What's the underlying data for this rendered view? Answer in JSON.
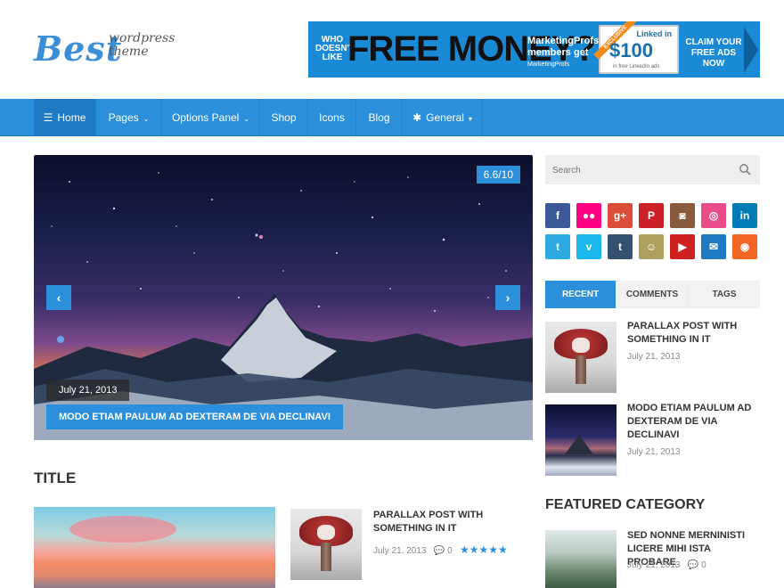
{
  "logo": {
    "name": "Best",
    "sub": "wordpress theme"
  },
  "banner": {
    "who": "WHO DOESN'T LIKE",
    "free": "FREE MONEY?",
    "mp": "MarketingProfs members get",
    "mp_small": "MarketingProfs",
    "card_brand": "Linked in",
    "card_amount": "$100",
    "card_small": "in free LinkedIn ads",
    "exclusive": "EXCLUSIVE",
    "claim": "CLAIM YOUR FREE ADS NOW"
  },
  "nav": {
    "items": [
      {
        "label": "Home",
        "icon": "bars-icon",
        "glyph": "☰"
      },
      {
        "label": "Pages",
        "caret": "⌄"
      },
      {
        "label": "Options Panel",
        "caret": "⌄"
      },
      {
        "label": "Shop"
      },
      {
        "label": "Icons"
      },
      {
        "label": "Blog"
      },
      {
        "label": "General",
        "icon": "asterisk-icon",
        "glyph": "✱",
        "caret": "▾"
      }
    ]
  },
  "slider": {
    "score": "6.6/10",
    "date": "July 21, 2013",
    "title": "MODO ETIAM PAULUM AD DEXTERAM DE VIA DECLINAVI",
    "prev": "‹",
    "next": "›"
  },
  "main": {
    "section_title": "TITLE",
    "post": {
      "title": "PARALLAX POST WITH SOMETHING IN IT",
      "date": "July 21, 2013",
      "comments": "0",
      "rating": 5,
      "rating_stars": "★★★★★"
    }
  },
  "sidebar": {
    "search_placeholder": "Search",
    "social": [
      {
        "name": "facebook-icon",
        "glyph": "f",
        "color": "#3b5998"
      },
      {
        "name": "flickr-icon",
        "glyph": "●●",
        "color": "#ff0084"
      },
      {
        "name": "google-plus-icon",
        "glyph": "g+",
        "color": "#dd4b39"
      },
      {
        "name": "pinterest-icon",
        "glyph": "P",
        "color": "#cb2027"
      },
      {
        "name": "instagram-icon",
        "glyph": "◙",
        "color": "#8a5a3c"
      },
      {
        "name": "dribbble-icon",
        "glyph": "◎",
        "color": "#ea4c89"
      },
      {
        "name": "linkedin-icon",
        "glyph": "in",
        "color": "#007bb6"
      },
      {
        "name": "twitter-icon",
        "glyph": "t",
        "color": "#2daae1"
      },
      {
        "name": "vimeo-icon",
        "glyph": "v",
        "color": "#1ab7ea"
      },
      {
        "name": "tumblr-icon",
        "glyph": "t",
        "color": "#34526f"
      },
      {
        "name": "github-icon",
        "glyph": "☺",
        "color": "#b0a060"
      },
      {
        "name": "youtube-icon",
        "glyph": "▶",
        "color": "#cd201f"
      },
      {
        "name": "email-icon",
        "glyph": "✉",
        "color": "#1d7ac3"
      },
      {
        "name": "rss-icon",
        "glyph": "◉",
        "color": "#f26522"
      }
    ],
    "tabs": [
      {
        "label": "RECENT",
        "active": true
      },
      {
        "label": "COMMENTS"
      },
      {
        "label": "TAGS"
      }
    ],
    "recent": [
      {
        "title": "PARALLAX POST WITH SOMETHING IN IT",
        "date": "July 21, 2013"
      },
      {
        "title": "MODO ETIAM PAULUM AD DEXTERAM DE VIA DECLINAVI",
        "date": "July 21, 2013"
      }
    ],
    "featured_title": "FEATURED CATEGORY",
    "featured": {
      "title": "SED NONNE MERNINISTI LICERE MIHI ISTA PROBARE",
      "date": "July 21, 2013",
      "comments": "0"
    }
  }
}
